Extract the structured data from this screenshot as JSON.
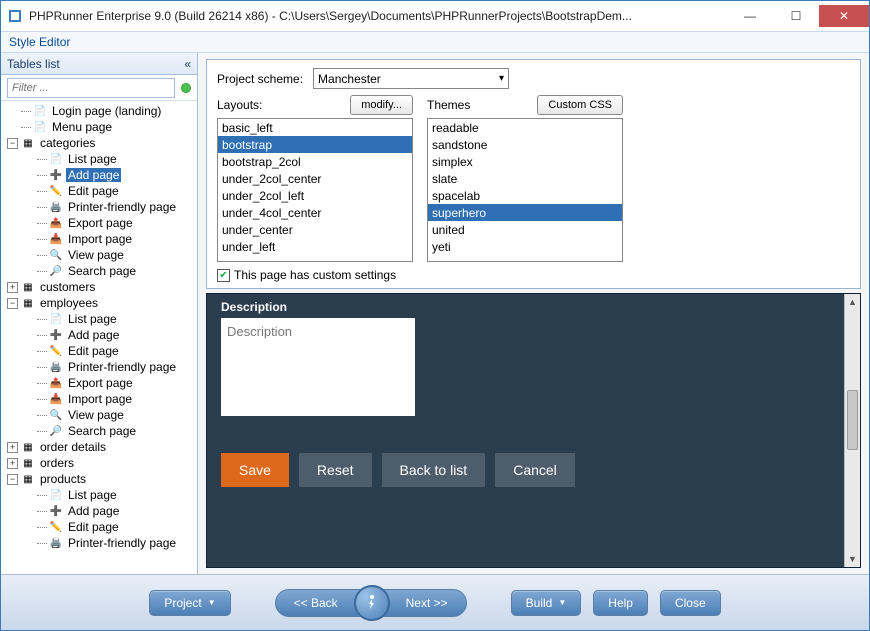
{
  "window": {
    "title": "PHPRunner Enterprise 9.0 (Build 26214 x86) - C:\\Users\\Sergey\\Documents\\PHPRunnerProjects\\BootstrapDem..."
  },
  "style_editor_label": "Style Editor",
  "sidebar": {
    "header": "Tables list",
    "filter_placeholder": "Filter ...",
    "nodes": {
      "login": "Login page (landing)",
      "menu": "Menu page",
      "categories": "categories",
      "list_page": "List page",
      "add_page": "Add page",
      "edit_page": "Edit page",
      "printer_page": "Printer-friendly page",
      "export_page": "Export page",
      "import_page": "Import page",
      "view_page": "View page",
      "search_page": "Search page",
      "customers": "customers",
      "employees": "employees",
      "order_details": "order details",
      "orders": "orders",
      "products": "products"
    }
  },
  "settings": {
    "project_scheme_label": "Project scheme:",
    "project_scheme_value": "Manchester",
    "layouts_label": "Layouts:",
    "modify_btn": "modify...",
    "themes_label": "Themes",
    "custom_css_btn": "Custom CSS",
    "layouts": [
      "basic_left",
      "bootstrap",
      "bootstrap_2col",
      "under_2col_center",
      "under_2col_left",
      "under_4col_center",
      "under_center",
      "under_left"
    ],
    "layouts_selected": "bootstrap",
    "themes": [
      "readable",
      "sandstone",
      "simplex",
      "slate",
      "spacelab",
      "superhero",
      "united",
      "yeti"
    ],
    "themes_selected": "superhero",
    "custom_settings_label": "This page has custom settings"
  },
  "preview": {
    "description_label": "Description",
    "description_value": "Description",
    "buttons": {
      "save": "Save",
      "reset": "Reset",
      "back": "Back to list",
      "cancel": "Cancel"
    }
  },
  "bottom": {
    "project": "Project",
    "back": "<<  Back",
    "next": "Next  >>",
    "build": "Build",
    "help": "Help",
    "close": "Close"
  }
}
